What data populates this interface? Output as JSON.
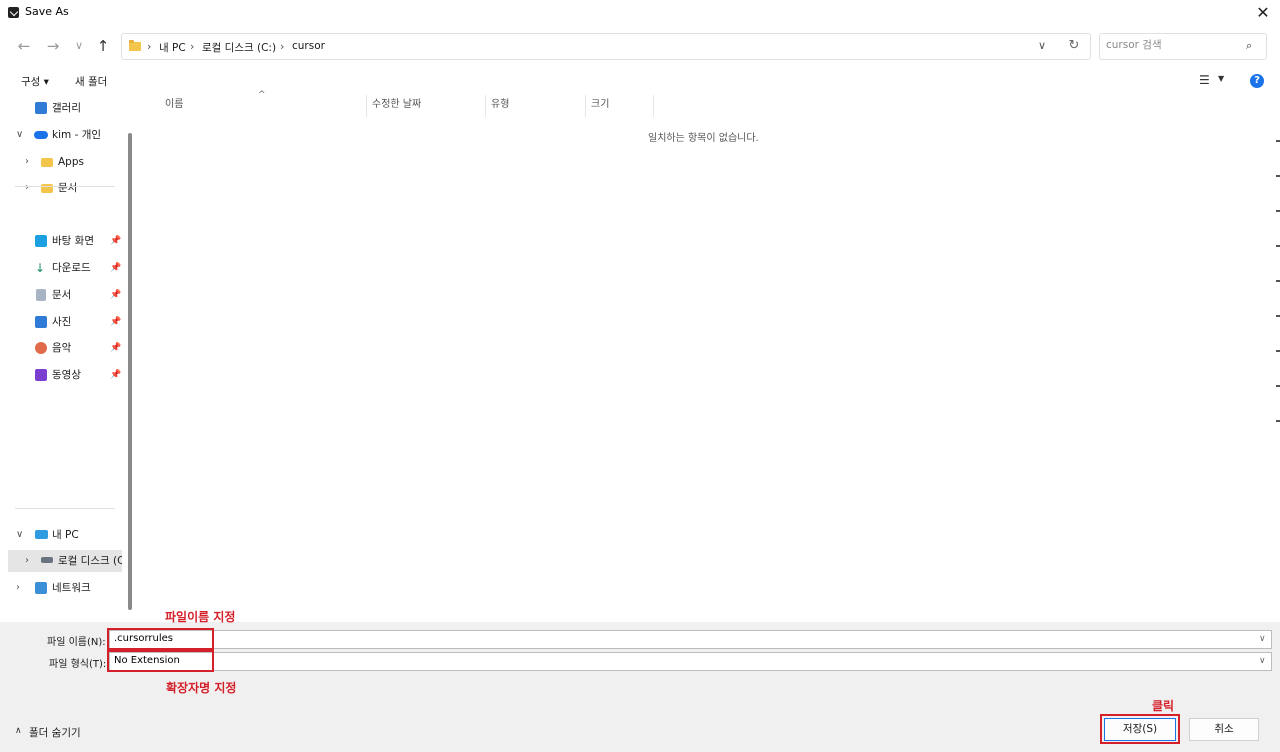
{
  "window": {
    "title": "Save As"
  },
  "address": {
    "crumbs": [
      "내 PC",
      "로컬 디스크 (C:)",
      "cursor"
    ],
    "sep": "›"
  },
  "search": {
    "placeholder": "cursor 검색"
  },
  "toolbar": {
    "organize": "구성 ▾",
    "new_folder": "새 폴더"
  },
  "sidebar": {
    "gallery": "갤러리",
    "onedrive": "kim - 개인",
    "apps": "Apps",
    "docs_sub": "문서",
    "quick": [
      "바탕 화면",
      "다운로드",
      "문서",
      "사진",
      "음악",
      "동영상"
    ],
    "this_pc": "내 PC",
    "local_disk": "로컬 디스크 (C",
    "network": "네트워크"
  },
  "columns": {
    "name": "이름",
    "modified": "수정한 날짜",
    "type": "유형",
    "size": "크기"
  },
  "empty_message": "일치하는 항목이 없습니다.",
  "form": {
    "filename_label": "파일 이름(N):",
    "filename_value": ".cursorrules",
    "filetype_label": "파일 형식(T):",
    "filetype_value": "No Extension"
  },
  "annotations": {
    "filename": "파일이름 지정",
    "extension": "확장자명 지정",
    "click": "클릭"
  },
  "footer": {
    "hide_folders": "폴더 숨기기",
    "save": "저장(S)",
    "cancel": "취소"
  },
  "colors": {
    "annotation": "#d4202a",
    "accent": "#1a73e8"
  }
}
